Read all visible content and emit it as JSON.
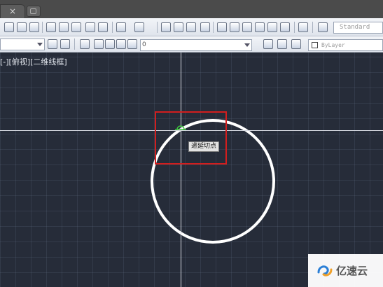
{
  "tabs": {
    "close_glyph": "×"
  },
  "toolbar": {
    "style_dropdown_value": "Standard",
    "layer_dropdown_value": "0",
    "color_dropdown_value": "ByLayer"
  },
  "drawing": {
    "viewport_label": "[-][俯视][二维线框]",
    "snap_tooltip": "递延切点",
    "crosshair_color": "#d8dbe2",
    "circle_color": "#ffffff",
    "highlight_color": "#d21e1e",
    "snap_marker_color": "#3ec43e"
  },
  "watermark": {
    "text": "亿速云"
  }
}
